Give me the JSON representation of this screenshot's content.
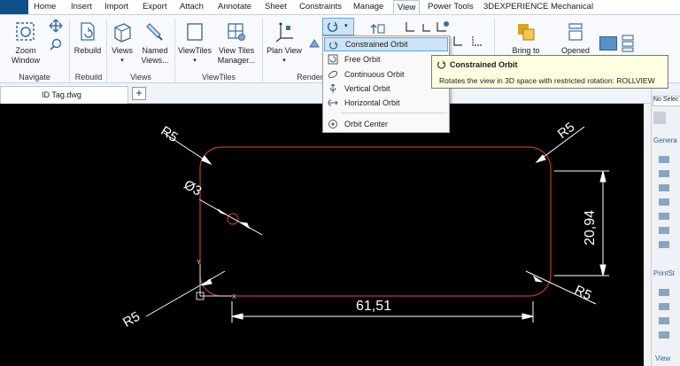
{
  "menu": {
    "tabs": [
      "Home",
      "Insert",
      "Import",
      "Export",
      "Attach",
      "Annotate",
      "Sheet",
      "Constraints",
      "Manage",
      "View",
      "Power Tools",
      "3DEXPERIENCE",
      "Mechanical"
    ],
    "active": "View"
  },
  "ribbon": {
    "zoom_window": "Zoom\nWindow",
    "rebuild": "Rebuild",
    "views": "Views",
    "named_views": "Named\nViews...",
    "viewtiles": "ViewTiles",
    "view_tiles_manager": "View Tiles\nManager...",
    "plan_view": "Plan View",
    "bring_to": "Bring to",
    "opened": "Opened",
    "groups": {
      "navigate": "Navigate",
      "rebuild": "Rebuild",
      "views": "Views",
      "viewtiles": "ViewTiles",
      "render": "Render"
    }
  },
  "doc_tab": {
    "name": "ID Tag.dwg",
    "plus": "+"
  },
  "orbit_menu": {
    "items": [
      {
        "label": "Constrained Orbit",
        "icon": "constrained-orbit-icon"
      },
      {
        "label": "Free Orbit",
        "icon": "free-orbit-icon"
      },
      {
        "label": "Continuous Orbit",
        "icon": "continuous-orbit-icon"
      },
      {
        "label": "Vertical Orbit",
        "icon": "vertical-orbit-icon"
      },
      {
        "label": "Horizontal Orbit",
        "icon": "horizontal-orbit-icon"
      },
      {
        "label": "Orbit Center",
        "icon": "orbit-center-icon"
      }
    ],
    "highlighted": "Constrained Orbit"
  },
  "tooltip": {
    "title": "Constrained Orbit",
    "description": "Rotates the view in 3D space with restricted rotation:  ROLLVIEW"
  },
  "drawing": {
    "r_top_left": "R5",
    "r_top_right": "R5",
    "r_bottom_left": "R5",
    "r_bottom_right": "R5",
    "diameter": "Ø3",
    "width": "61,51",
    "height": "20,94",
    "ucs_x": "X",
    "ucs_y": "Y"
  },
  "panel": {
    "selection": "No Selec",
    "general": "Genera",
    "printstyle": "PrintSt",
    "view": "View"
  },
  "colors": {
    "accent": "#0f4f8a",
    "highlight": "#cce4f7",
    "outline": "#c0392b"
  }
}
